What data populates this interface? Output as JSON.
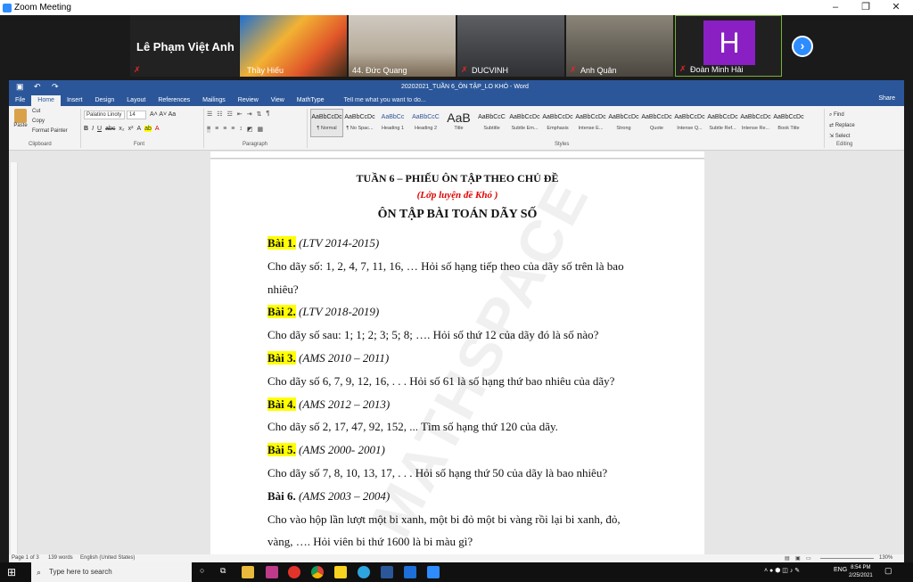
{
  "zoom": {
    "title": "Zoom Meeting",
    "window_controls": [
      "–",
      "❐",
      "✕"
    ],
    "big_name": "Lê Phạm Việt Anh",
    "participants": [
      "Thầy Hiếu",
      "44. Đức Quang",
      "DUCVINH",
      "Anh Quân",
      "Đoàn Minh Hải"
    ],
    "avatar_letter": "H",
    "next_glyph": "›"
  },
  "word": {
    "doc_title": "20202021_TUẦN 6_ÔN TẬP_LO KHÓ - Word",
    "tabs": [
      "File",
      "Home",
      "Insert",
      "Design",
      "Layout",
      "References",
      "Mailings",
      "Review",
      "View",
      "MathType"
    ],
    "tell_me": "Tell me what you want to do...",
    "share": "Share",
    "clipboard": {
      "paste": "Paste",
      "cut": "Cut",
      "copy": "Copy",
      "format_painter": "Format Painter",
      "label": "Clipboard"
    },
    "font": {
      "name": "Palatino Linoty",
      "size": "14",
      "label": "Font",
      "row1_extra": "A˄ A˅ Aa",
      "row2": [
        "B",
        "I",
        "U",
        "abc",
        "x₂",
        "x²",
        "A",
        "ab",
        "A"
      ]
    },
    "paragraph_label": "Paragraph",
    "styles_label": "Styles",
    "editing": {
      "find": "Find",
      "replace": "Replace",
      "select": "Select",
      "label": "Editing"
    },
    "styles": [
      {
        "preview": "AaBbCcDc",
        "label": "¶ Normal"
      },
      {
        "preview": "AaBbCcDc",
        "label": "¶ No Spac..."
      },
      {
        "preview": "AaBbCc",
        "label": "Heading 1"
      },
      {
        "preview": "AaBbCcC",
        "label": "Heading 2"
      },
      {
        "preview": "AaB",
        "label": "Title"
      },
      {
        "preview": "AaBbCcC",
        "label": "Subtitle"
      },
      {
        "preview": "AaBbCcDc",
        "label": "Subtle Em..."
      },
      {
        "preview": "AaBbCcDc",
        "label": "Emphasis"
      },
      {
        "preview": "AaBbCcDc",
        "label": "Intense E..."
      },
      {
        "preview": "AaBbCcDc",
        "label": "Strong"
      },
      {
        "preview": "AaBbCcDc",
        "label": "Quote"
      },
      {
        "preview": "AaBbCcDc",
        "label": "Intense Q..."
      },
      {
        "preview": "AaBbCcDc",
        "label": "Subtle Ref..."
      },
      {
        "preview": "AaBbCcDc",
        "label": "Intense Re..."
      },
      {
        "preview": "AaBbCcDc",
        "label": "Book Title"
      }
    ],
    "document": {
      "heading1": "TUẦN 6 – PHIẾU ÔN TẬP THEO CHỦ ĐỀ",
      "heading2": "(Lớp luyện đề Khó )",
      "heading3": "ÔN TẬP BÀI TOÁN DÃY SỐ",
      "watermark": "MATHSPACE",
      "lines": [
        {
          "label": "Bài 1.",
          "src": "(LTV 2014-2015)"
        },
        {
          "text": "Cho dãy số: 1, 2, 4, 7, 11, 16, … Hỏi số hạng tiếp theo của dãy số trên là bao"
        },
        {
          "text": "nhiêu?"
        },
        {
          "label": "Bài 2.",
          "src": "(LTV 2018-2019)"
        },
        {
          "text": "Cho dãy số sau: 1; 1; 2; 3; 5; 8; …. Hỏi số thứ 12 của dãy đó là số nào?"
        },
        {
          "label": "Bài 3.",
          "src": "(AMS 2010 – 2011)"
        },
        {
          "text": "Cho dãy số 6, 7, 9, 12, 16, . . . Hỏi số 61 là số hạng thứ bao nhiêu của dãy?"
        },
        {
          "label": "Bài 4.",
          "src": "(AMS 2012 – 2013)"
        },
        {
          "text": "Cho dãy số 2, 17, 47, 92, 152, ... Tìm số hạng thứ 120 của dãy."
        },
        {
          "label": "Bài 5.",
          "src": "(AMS 2000- 2001)"
        },
        {
          "text": "Cho dãy số 7, 8, 10, 13, 17, . . . Hỏi số hạng thứ 50 của dãy là bao nhiêu?"
        },
        {
          "label": "Bài 6.",
          "src": "(AMS 2003 – 2004)"
        },
        {
          "text": "Cho vào hộp lần lượt một bi xanh, một bi đỏ một bi vàng rồi lại bi xanh, đỏ,"
        },
        {
          "text": "vàng, …. Hỏi viên bi thứ 1600 là bi màu gì?"
        }
      ]
    },
    "status": {
      "page": "Page 1 of 3",
      "words": "139 words",
      "lang": "English (United States)",
      "zoom": "130%"
    }
  },
  "taskbar": {
    "search_placeholder": "Type here to search",
    "lang": "ENG",
    "time": "8:54 PM",
    "date": "2/25/2021"
  },
  "colors": {
    "word_blue": "#2b579a",
    "highlight": "#ffff00",
    "zoom_blue": "#2d8cff",
    "avatar_purple": "#8a1fc4",
    "heading_red": "#e00000"
  }
}
